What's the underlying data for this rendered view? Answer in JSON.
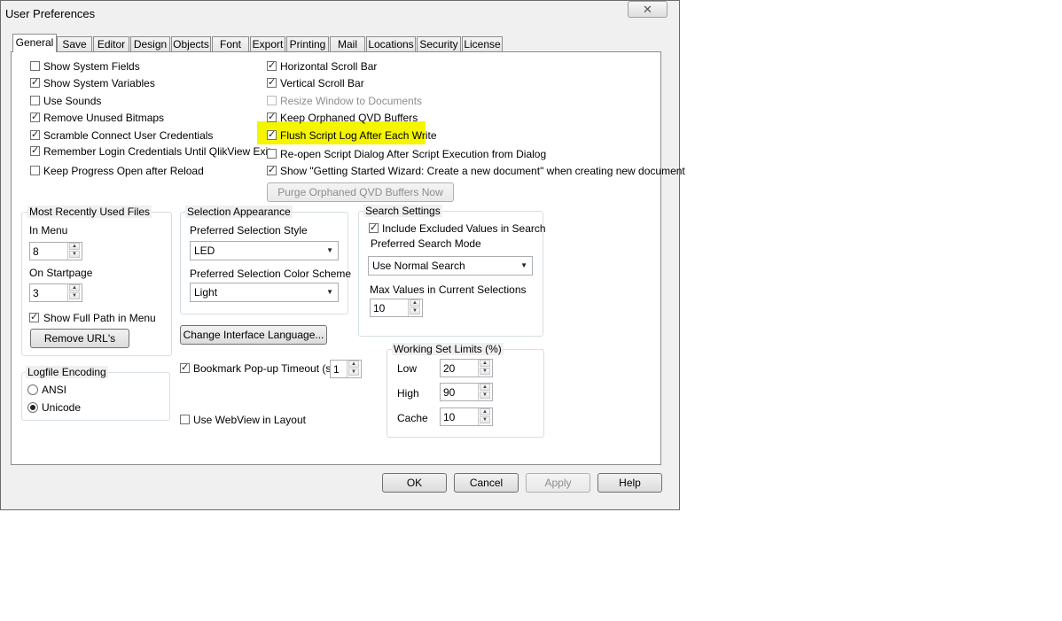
{
  "window": {
    "title": "User Preferences",
    "close_glyph": "✕"
  },
  "tabs": [
    "General",
    "Save",
    "Editor",
    "Design",
    "Objects",
    "Font",
    "Export",
    "Printing",
    "Mail",
    "Locations",
    "Security",
    "License"
  ],
  "general": {
    "left_checks": [
      {
        "label": "Show System Fields",
        "checked": false
      },
      {
        "label": "Show System Variables",
        "checked": true
      },
      {
        "label": "Use Sounds",
        "checked": false
      },
      {
        "label": "Remove Unused Bitmaps",
        "checked": true
      },
      {
        "label": "Scramble Connect User Credentials",
        "checked": true
      },
      {
        "label": "Remember Login Credentials Until QlikView Exits",
        "checked": true
      },
      {
        "label": "Keep Progress Open after Reload",
        "checked": false
      }
    ],
    "right_checks": [
      {
        "label": "Horizontal Scroll Bar",
        "checked": true,
        "disabled": false
      },
      {
        "label": "Vertical Scroll Bar",
        "checked": true,
        "disabled": false
      },
      {
        "label": "Resize Window to Documents",
        "checked": false,
        "disabled": true
      },
      {
        "label": "Keep Orphaned QVD Buffers",
        "checked": true,
        "disabled": false
      },
      {
        "label": "Flush Script Log After Each Write",
        "checked": true,
        "disabled": false
      },
      {
        "label": "Re-open Script Dialog After Script Execution from Dialog",
        "checked": false,
        "disabled": false
      },
      {
        "label": "Show \"Getting Started Wizard: Create a new document\" when creating new document",
        "checked": true,
        "disabled": false
      }
    ],
    "purge_button": "Purge Orphaned QVD Buffers Now",
    "mru": {
      "title": "Most Recently Used Files",
      "in_menu_label": "In Menu",
      "in_menu_value": "8",
      "on_startpage_label": "On Startpage",
      "on_startpage_value": "3",
      "show_full_path_label": "Show Full Path in Menu",
      "show_full_path_checked": true,
      "remove_button": "Remove URL's"
    },
    "logfile": {
      "title": "Logfile Encoding",
      "options": [
        "ANSI",
        "Unicode"
      ],
      "selected": "Unicode"
    },
    "selection": {
      "title": "Selection Appearance",
      "style_label": "Preferred Selection Style",
      "style_value": "LED",
      "color_label": "Preferred Selection Color Scheme",
      "color_value": "Light"
    },
    "change_language_button": "Change Interface Language...",
    "bookmark": {
      "label": "Bookmark Pop-up Timeout (s)",
      "checked": true,
      "value": "1"
    },
    "webview": {
      "label": "Use WebView in Layout",
      "checked": false
    },
    "search": {
      "title": "Search Settings",
      "include_excluded_label": "Include Excluded Values in Search",
      "include_excluded_checked": true,
      "mode_label": "Preferred Search Mode",
      "mode_value": "Use Normal Search",
      "max_values_label": "Max Values in Current Selections",
      "max_values_value": "10"
    },
    "working_set": {
      "title": "Working Set Limits (%)",
      "low_label": "Low",
      "low_value": "20",
      "high_label": "High",
      "high_value": "90",
      "cache_label": "Cache",
      "cache_value": "10"
    }
  },
  "footer": {
    "ok": "OK",
    "cancel": "Cancel",
    "apply": "Apply",
    "help": "Help"
  },
  "colors": {
    "highlight": "#f5f500"
  }
}
